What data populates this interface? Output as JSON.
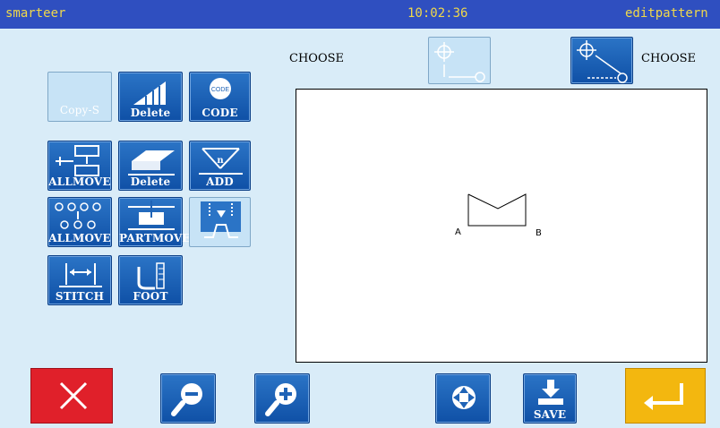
{
  "app": {
    "brand": "smarteer",
    "time": "10:02:36",
    "mode": "editpattern"
  },
  "header": {
    "choose_left": "CHOOSE",
    "choose_right": "CHOOSE"
  },
  "tools": {
    "copy_s": "Copy-S",
    "delete_stitch": "Delete",
    "code": "CODE",
    "code_icon_text": "CODE",
    "allmove": "ALLMOVE",
    "delete_block": "Delete",
    "add": "ADD",
    "add_icon_text": "n",
    "allmove2": "ALLMOVE",
    "partmove": "PARTMOVE",
    "stitch": "STITCH",
    "foot": "FOOT"
  },
  "pattern": {
    "point_a": "A",
    "point_b": "B"
  },
  "bottom": {
    "save": "SAVE"
  },
  "colors": {
    "topbar": "#2f4fc0",
    "topbar_text": "#f0d84a",
    "background": "#d9ecf8",
    "button_blue": "#1f63b6",
    "cancel_red": "#e0202a",
    "enter_yellow": "#f3b70f"
  }
}
